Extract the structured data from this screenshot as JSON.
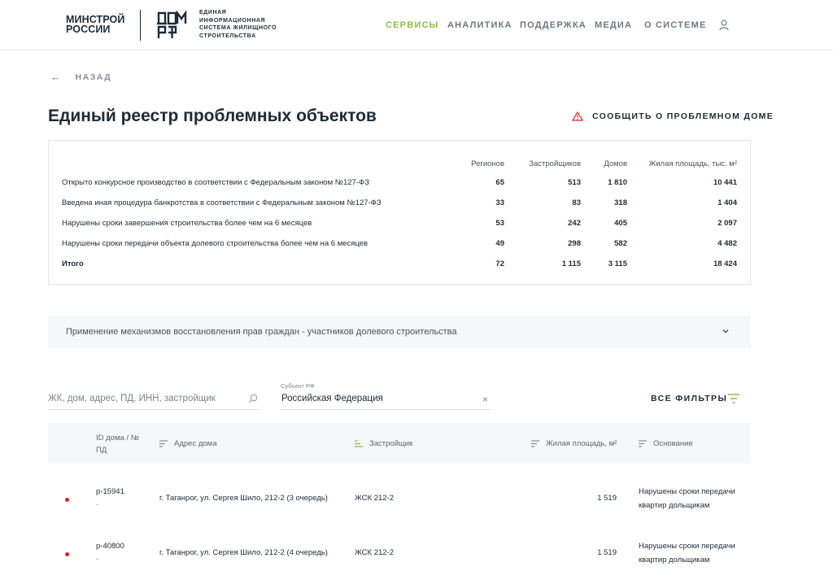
{
  "header": {
    "minstroy_line1": "МИНСТРОЙ",
    "minstroy_line2": "РОССИИ",
    "eisgs_lines": [
      "ЕДИНАЯ",
      "ИНФОРМАЦИОННАЯ",
      "СИСТЕМА ЖИЛИЩНОГО",
      "СТРОИТЕЛЬСТВА"
    ],
    "nav": [
      "СЕРВИСЫ",
      "АНАЛИТИКА",
      "ПОДДЕРЖКА",
      "МЕДИА",
      "О СИСТЕМЕ"
    ],
    "active_nav": "СЕРВИСЫ",
    "accent_color": "#8dbf42"
  },
  "back_label": "НАЗАД",
  "page_title": "Единый реестр проблемных объектов",
  "report_label": "СООБЩИТЬ О ПРОБЛЕМНОМ ДОМЕ",
  "stats": {
    "columns": [
      "Регионов",
      "Застройщиков",
      "Домов",
      "Жилая площадь, тыс. м²"
    ],
    "rows": [
      {
        "label": "Открыто конкурсное производство в соответствии с Федеральным законом №127-ФЗ",
        "values": [
          "65",
          "513",
          "1 810",
          "10 441"
        ]
      },
      {
        "label": "Введена иная процедура банкротства в соответствии с Федеральным законом №127-ФЗ",
        "values": [
          "33",
          "83",
          "318",
          "1 404"
        ]
      },
      {
        "label": "Нарушены сроки завершения строительства более чем на 6 месяцев",
        "values": [
          "53",
          "242",
          "405",
          "2 097"
        ]
      },
      {
        "label": "Нарушены сроки передачи объекта долевого строительства более чем на 6 месяцев",
        "values": [
          "49",
          "298",
          "582",
          "4 482"
        ]
      }
    ],
    "total": {
      "label": "Итого",
      "values": [
        "72",
        "1 115",
        "3 115",
        "18 424"
      ]
    }
  },
  "accordion_label": "Применение механизмов восстановления прав граждан - участников долевого строительства",
  "filters": {
    "search_placeholder": "ЖК, дом, адрес, ПД, ИНН, застройщик",
    "subject_label": "Субъект РФ",
    "subject_value": "Российская Федерация",
    "clear_symbol": "×",
    "all_filters_label": "ВСЕ ФИЛЬТРЫ"
  },
  "table": {
    "columns": {
      "id_line1": "ID дома / №",
      "id_line2": "ПД",
      "address": "Адрес дома",
      "developer": "Застройщик",
      "area": "Жилая площадь, м²",
      "reason": "Основание"
    },
    "rows": [
      {
        "id": "р-15941",
        "pd": "-",
        "address": "г. Таганрог, ул. Сергея Шило, 212-2 (3 очередь)",
        "developer": "ЖСК 212-2",
        "area": "1 519",
        "reason_line1": "Нарушены сроки передачи",
        "reason_line2": "квартир дольщикам"
      },
      {
        "id": "р-40800",
        "pd": "-",
        "address": "г. Таганрог, ул. Сергея Шило, 212-2 (4 очередь)",
        "developer": "ЖСК 212-2",
        "area": "1 519",
        "reason_line1": "Нарушены сроки передачи",
        "reason_line2": "квартир дольщикам"
      }
    ],
    "status_color": "#d9222a"
  }
}
